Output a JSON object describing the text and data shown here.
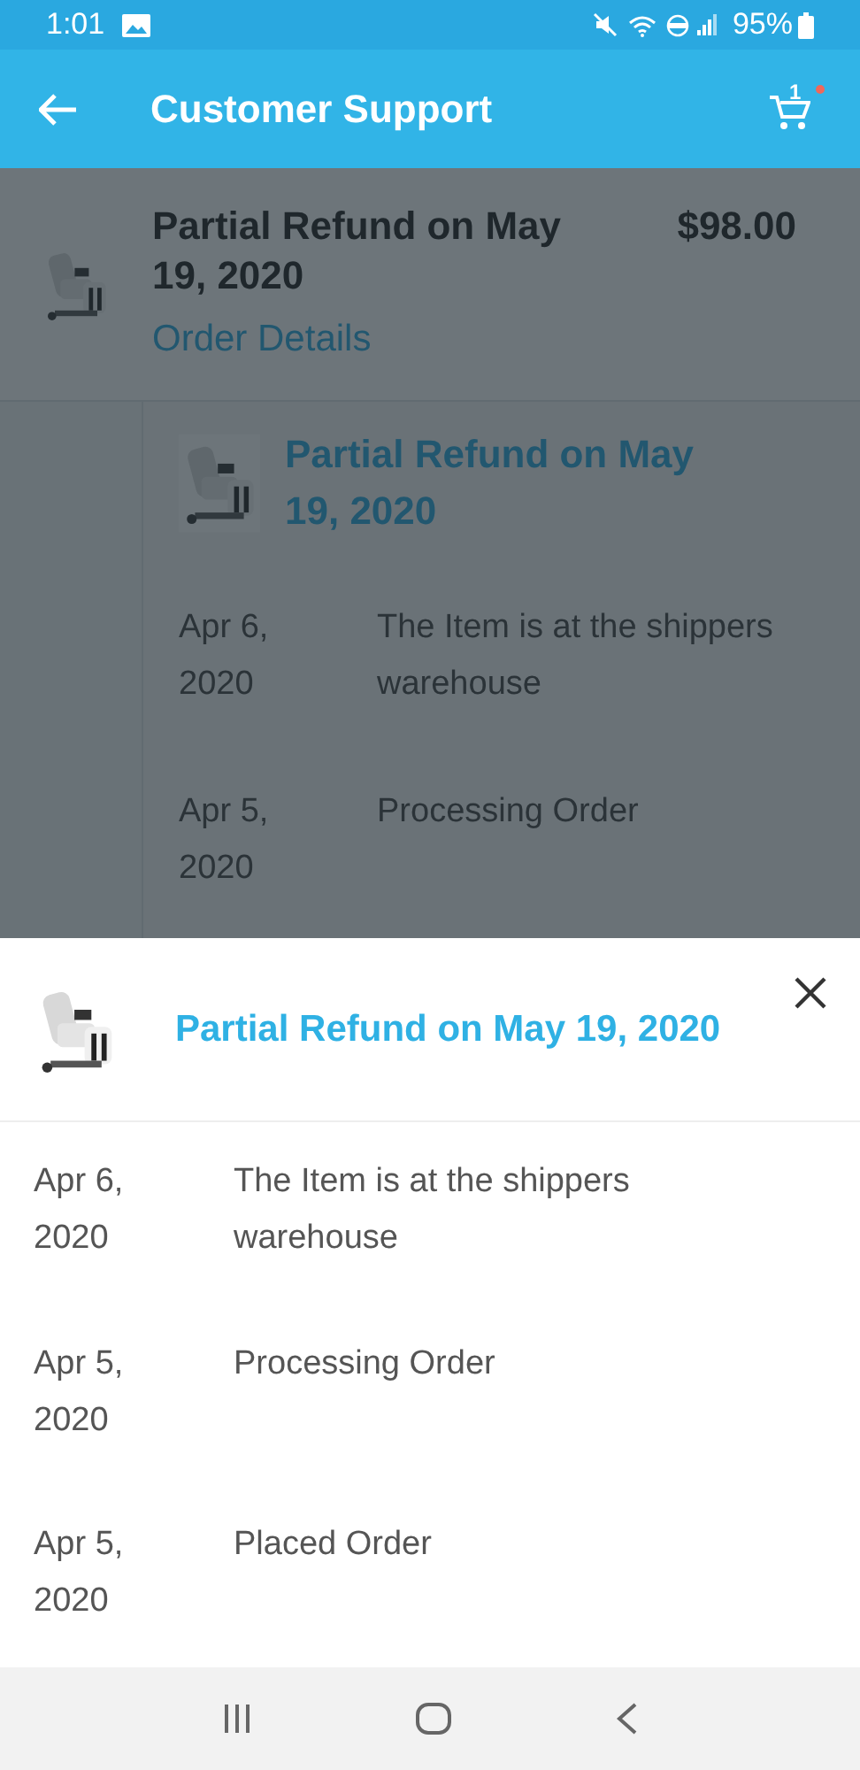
{
  "status_bar": {
    "time": "1:01",
    "battery": "95%"
  },
  "app_bar": {
    "title": "Customer Support",
    "cart_count": "1"
  },
  "background": {
    "order": {
      "title": "Partial Refund on May 19, 2020",
      "amount": "$98.00",
      "link": "Order Details"
    },
    "details": {
      "title": "Partial Refund on May 19, 2020",
      "events": [
        {
          "date": "Apr 6, 2020",
          "description": "The Item is at the shippers warehouse"
        },
        {
          "date": "Apr 5, 2020",
          "description": "Processing Order"
        }
      ]
    }
  },
  "sheet": {
    "title": "Partial Refund on May 19, 2020",
    "events": [
      {
        "date": "Apr 6, 2020",
        "description": "The Item is at the shippers warehouse"
      },
      {
        "date": "Apr 5, 2020",
        "description": "Processing Order"
      },
      {
        "date": "Apr 5, 2020",
        "description": "Placed Order"
      }
    ]
  }
}
